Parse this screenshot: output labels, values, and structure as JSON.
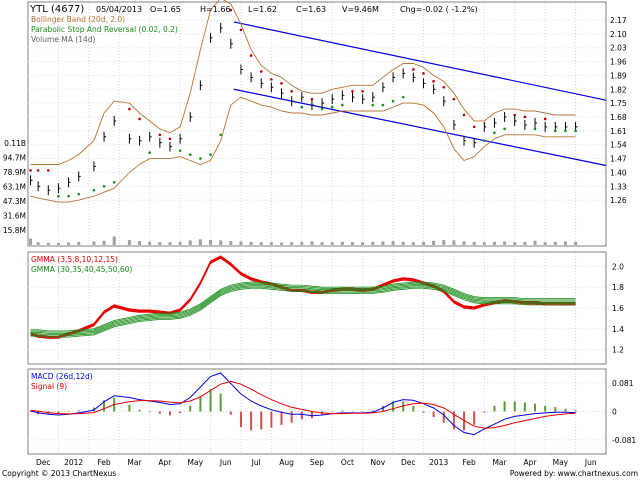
{
  "header": {
    "symbol": "YTL (4677)",
    "date": "05/04/2013",
    "open": "O=1.65",
    "high": "H=1.66",
    "low": "L=1.62",
    "close": "C=1.63",
    "volume": "V=9.46M",
    "change": "Chg=-0.02 ( -1.2%)"
  },
  "footer": {
    "copyright": "Copyright © 2013 ChartNexus",
    "powered": "Powered by: www.chartnexus.com"
  },
  "colors": {
    "price_bar": "#000000",
    "bollinger": "#b87333",
    "sar": "#1a8c1a",
    "volume_ma": "#808080",
    "channel": "#0000e6",
    "gmma_short": "#e60000",
    "gmma_long": "#1a8c1a",
    "macd": "#0000e6",
    "signal": "#e60000",
    "hist_pos": "#5a9a3a",
    "hist_neg": "#d05050"
  },
  "chart_data": [
    {
      "type": "line",
      "panel": "price",
      "legend": [
        {
          "name": "Bollinger Band (20d, 2.0)",
          "color": "#b87333"
        },
        {
          "name": "Parabolic Stop And Reversal (0.02, 0.2)",
          "color": "#1a8c1a"
        },
        {
          "name": "Volume MA (14d)",
          "color": "#808080"
        }
      ],
      "x_ticks": [
        "Dec",
        "2012",
        "Feb",
        "Mar",
        "Apr",
        "May",
        "Jun",
        "Jul",
        "Aug",
        "Sep",
        "Oct",
        "Nov",
        "Dec",
        "2013",
        "Feb",
        "Mar",
        "Apr",
        "May",
        "Jun"
      ],
      "y_ticks": [
        "2.17",
        "2.10",
        "2.03",
        "1.96",
        "1.89",
        "1.82",
        "1.75",
        "1.68",
        "1.61",
        "1.54",
        "1.47",
        "1.40",
        "1.33",
        "1.26"
      ],
      "y_range": [
        1.2,
        2.18
      ],
      "volume_ticks": [
        "0.11B",
        "94.7M",
        "78.9M",
        "63.1M",
        "47.3M",
        "31.6M",
        "15.8M"
      ],
      "price_x": [
        1,
        4,
        8,
        12,
        16,
        20,
        26,
        30,
        34,
        40,
        44,
        48,
        52,
        56,
        60,
        64,
        68,
        72,
        76,
        80,
        84,
        88,
        92,
        96,
        100,
        104,
        108,
        112,
        116,
        120,
        124,
        128,
        132,
        136,
        140,
        144,
        148,
        152,
        156,
        160,
        164,
        168,
        172,
        176,
        180,
        184,
        188,
        192,
        196,
        200,
        204,
        208,
        212,
        216
      ],
      "close": [
        1.36,
        1.33,
        1.31,
        1.32,
        1.35,
        1.38,
        1.43,
        1.58,
        1.66,
        1.57,
        1.56,
        1.58,
        1.55,
        1.53,
        1.57,
        1.68,
        1.84,
        2.08,
        2.13,
        2.05,
        1.92,
        1.88,
        1.85,
        1.83,
        1.8,
        1.76,
        1.78,
        1.74,
        1.75,
        1.77,
        1.79,
        1.78,
        1.77,
        1.78,
        1.83,
        1.88,
        1.9,
        1.88,
        1.85,
        1.82,
        1.76,
        1.64,
        1.56,
        1.55,
        1.63,
        1.65,
        1.68,
        1.66,
        1.64,
        1.65,
        1.63,
        1.63,
        1.63,
        1.63
      ],
      "bollinger_upper": [
        1.44,
        1.44,
        1.44,
        1.44,
        1.46,
        1.49,
        1.56,
        1.7,
        1.76,
        1.75,
        1.7,
        1.66,
        1.62,
        1.6,
        1.63,
        1.8,
        2.02,
        2.22,
        2.28,
        2.25,
        2.15,
        2.02,
        1.94,
        1.9,
        1.88,
        1.84,
        1.81,
        1.8,
        1.8,
        1.82,
        1.83,
        1.84,
        1.84,
        1.84,
        1.88,
        1.92,
        1.95,
        1.95,
        1.93,
        1.89,
        1.86,
        1.8,
        1.72,
        1.66,
        1.66,
        1.7,
        1.72,
        1.72,
        1.71,
        1.71,
        1.7,
        1.69,
        1.69,
        1.69
      ],
      "bollinger_lower": [
        1.28,
        1.27,
        1.26,
        1.25,
        1.25,
        1.26,
        1.28,
        1.3,
        1.32,
        1.4,
        1.44,
        1.47,
        1.47,
        1.47,
        1.48,
        1.46,
        1.44,
        1.46,
        1.56,
        1.74,
        1.78,
        1.76,
        1.74,
        1.73,
        1.71,
        1.7,
        1.7,
        1.69,
        1.69,
        1.7,
        1.71,
        1.71,
        1.71,
        1.71,
        1.71,
        1.73,
        1.75,
        1.75,
        1.74,
        1.7,
        1.63,
        1.52,
        1.46,
        1.48,
        1.53,
        1.57,
        1.59,
        1.59,
        1.59,
        1.59,
        1.58,
        1.58,
        1.58,
        1.58
      ],
      "channel_upper": [
        [
          2.16,
          2.165
        ],
        [
          2.0,
          1.765
        ]
      ],
      "channel_lower": [
        [
          1.82,
          1.83
        ],
        [
          1.56,
          1.435
        ]
      ],
      "volume_millions": [
        18,
        8,
        6,
        6,
        7,
        9,
        10,
        12,
        24,
        14,
        11,
        9,
        8,
        8,
        9,
        13,
        16,
        14,
        13,
        11,
        10,
        9,
        8,
        8,
        7,
        8,
        9,
        10,
        8,
        8,
        9,
        8,
        8,
        9,
        10,
        11,
        9,
        8,
        9,
        12,
        14,
        13,
        10,
        9,
        8,
        9,
        10,
        8,
        9,
        12,
        8,
        9,
        10,
        9
      ]
    },
    {
      "type": "line",
      "panel": "gmma",
      "legend": [
        {
          "name": "GMMA (3,5,8,10,12,15)",
          "color": "#e60000"
        },
        {
          "name": "GMMA (30,35,40,45,50,60)",
          "color": "#1a8c1a"
        }
      ],
      "y_ticks": [
        "2.0",
        "1.8",
        "1.6",
        "1.4",
        "1.2"
      ],
      "y_range": [
        1.1,
        2.1
      ],
      "short_mean": [
        1.35,
        1.33,
        1.32,
        1.32,
        1.35,
        1.38,
        1.44,
        1.56,
        1.62,
        1.58,
        1.57,
        1.57,
        1.56,
        1.55,
        1.58,
        1.68,
        1.84,
        2.04,
        2.09,
        2.02,
        1.93,
        1.88,
        1.85,
        1.83,
        1.8,
        1.77,
        1.77,
        1.75,
        1.75,
        1.77,
        1.78,
        1.78,
        1.77,
        1.78,
        1.82,
        1.86,
        1.88,
        1.87,
        1.84,
        1.81,
        1.76,
        1.66,
        1.61,
        1.6,
        1.63,
        1.65,
        1.67,
        1.66,
        1.65,
        1.65,
        1.64,
        1.64,
        1.64,
        1.64
      ],
      "long_mean": [
        1.36,
        1.36,
        1.35,
        1.35,
        1.35,
        1.36,
        1.37,
        1.41,
        1.45,
        1.48,
        1.5,
        1.51,
        1.52,
        1.52,
        1.53,
        1.56,
        1.61,
        1.68,
        1.75,
        1.79,
        1.81,
        1.82,
        1.82,
        1.81,
        1.8,
        1.79,
        1.79,
        1.78,
        1.77,
        1.77,
        1.77,
        1.77,
        1.77,
        1.77,
        1.78,
        1.8,
        1.81,
        1.82,
        1.82,
        1.81,
        1.79,
        1.75,
        1.71,
        1.68,
        1.67,
        1.67,
        1.67,
        1.67,
        1.66,
        1.66,
        1.66,
        1.66,
        1.66,
        1.66
      ]
    },
    {
      "type": "line",
      "panel": "macd",
      "legend": [
        {
          "name": "MACD (26d,12d)",
          "color": "#0000e6"
        },
        {
          "name": "Signal (9)",
          "color": "#e60000"
        }
      ],
      "y_ticks": [
        "0.081",
        "0",
        "-0.081"
      ],
      "y_range": [
        -0.11,
        0.11
      ],
      "macd": [
        0.002,
        -0.004,
        -0.008,
        -0.01,
        -0.008,
        -0.004,
        0.004,
        0.028,
        0.045,
        0.04,
        0.034,
        0.03,
        0.026,
        0.02,
        0.022,
        0.04,
        0.07,
        0.1,
        0.11,
        0.08,
        0.05,
        0.03,
        0.016,
        0.005,
        -0.002,
        -0.008,
        -0.008,
        -0.012,
        -0.01,
        -0.006,
        -0.004,
        -0.004,
        -0.004,
        -0.002,
        0.01,
        0.026,
        0.034,
        0.032,
        0.022,
        0.01,
        -0.01,
        -0.04,
        -0.06,
        -0.066,
        -0.05,
        -0.036,
        -0.022,
        -0.014,
        -0.01,
        -0.006,
        -0.004,
        -0.002,
        -0.002,
        -0.003
      ],
      "signal": [
        0.003,
        0.001,
        -0.003,
        -0.006,
        -0.007,
        -0.006,
        -0.003,
        0.008,
        0.02,
        0.028,
        0.031,
        0.031,
        0.03,
        0.027,
        0.025,
        0.03,
        0.042,
        0.06,
        0.078,
        0.086,
        0.078,
        0.064,
        0.048,
        0.034,
        0.022,
        0.012,
        0.006,
        0.0,
        -0.004,
        -0.006,
        -0.006,
        -0.005,
        -0.005,
        -0.004,
        0.0,
        0.008,
        0.016,
        0.022,
        0.024,
        0.02,
        0.01,
        -0.008,
        -0.026,
        -0.042,
        -0.048,
        -0.046,
        -0.04,
        -0.032,
        -0.026,
        -0.02,
        -0.014,
        -0.01,
        -0.007,
        -0.005
      ]
    }
  ]
}
